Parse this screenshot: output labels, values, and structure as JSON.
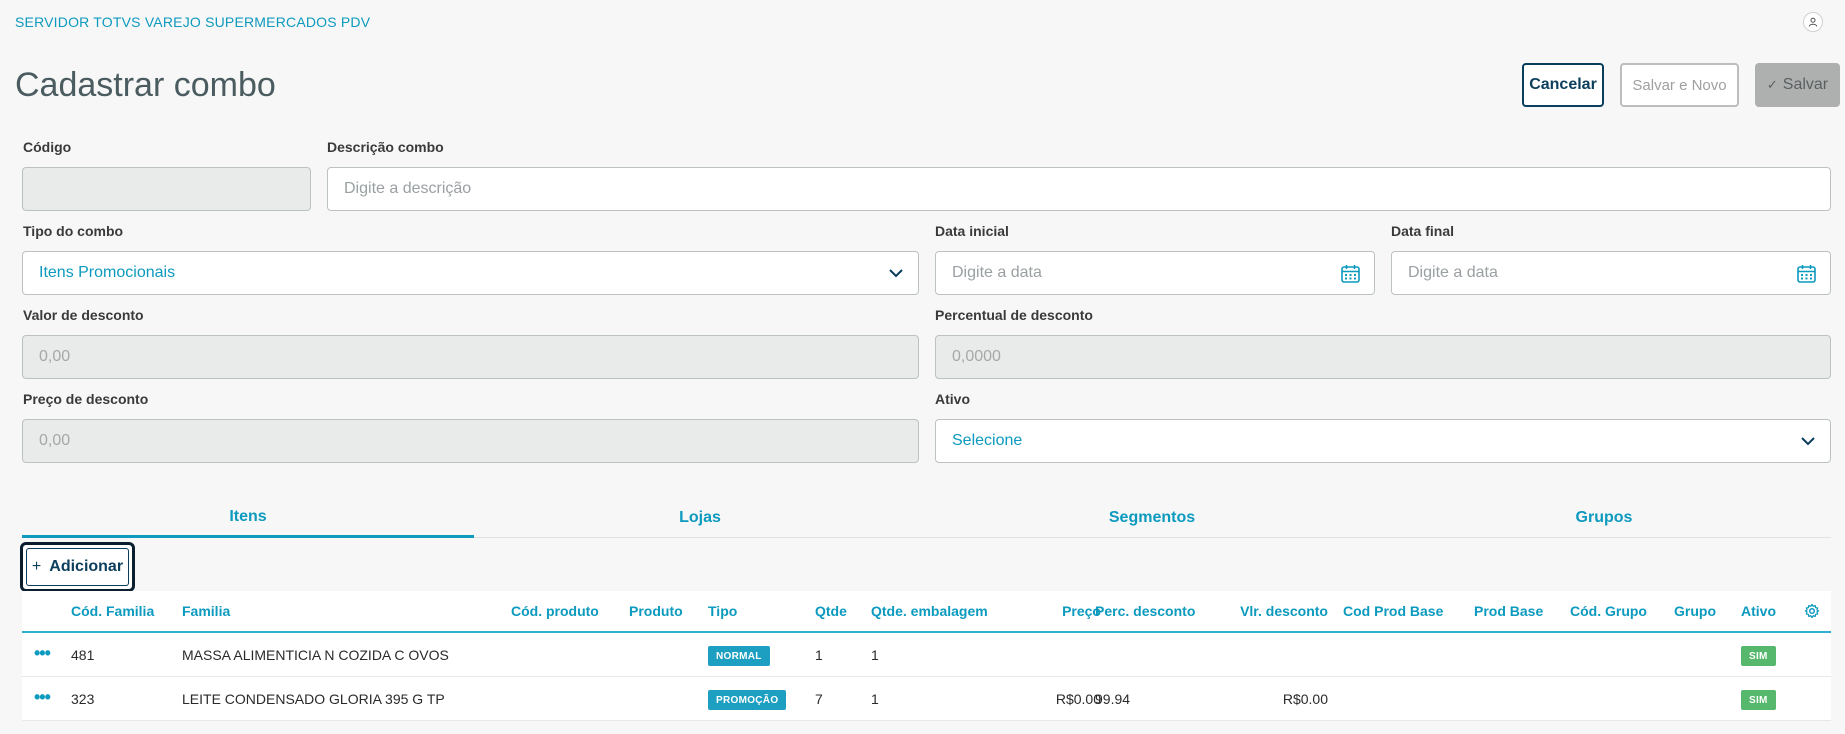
{
  "app": {
    "title": "SERVIDOR TOTVS VAREJO SUPERMERCADOS PDV"
  },
  "page": {
    "title": "Cadastrar combo"
  },
  "actions": {
    "cancel": "Cancelar",
    "save_new": "Salvar e Novo",
    "save": "Salvar"
  },
  "form": {
    "codigo": {
      "label": "Código",
      "value": ""
    },
    "descricao": {
      "label": "Descrição combo",
      "placeholder": "Digite a descrição"
    },
    "tipo": {
      "label": "Tipo do combo",
      "value": "Itens Promocionais"
    },
    "data_inicial": {
      "label": "Data inicial",
      "placeholder": "Digite a data"
    },
    "data_final": {
      "label": "Data final",
      "placeholder": "Digite a data"
    },
    "valor_desconto": {
      "label": "Valor de desconto",
      "placeholder": "0,00"
    },
    "percentual_desconto": {
      "label": "Percentual de desconto",
      "placeholder": "0,0000"
    },
    "preco_desconto": {
      "label": "Preço de desconto",
      "placeholder": "0,00"
    },
    "ativo": {
      "label": "Ativo",
      "value": "Selecione"
    }
  },
  "tabs": [
    {
      "label": "Itens",
      "active": true
    },
    {
      "label": "Lojas",
      "active": false
    },
    {
      "label": "Segmentos",
      "active": false
    },
    {
      "label": "Grupos",
      "active": false
    }
  ],
  "add_button": {
    "label": "Adicionar"
  },
  "table": {
    "columns": [
      "Cód. Familia",
      "Familia",
      "Cód. produto",
      "Produto",
      "Tipo",
      "Qtde",
      "Qtde. embalagem",
      "Preço",
      "Perc. desconto",
      "Vlr. desconto",
      "Cod Prod Base",
      "Prod Base",
      "Cód. Grupo",
      "Grupo",
      "Ativo"
    ],
    "rows": [
      {
        "cod_familia": "481",
        "familia": "MASSA ALIMENTICIA N COZIDA C OVOS",
        "cod_produto": "",
        "produto": "",
        "tipo": "NORMAL",
        "qtde": "1",
        "qtde_embalagem": "1",
        "preco": "",
        "perc_desconto": "",
        "vlr_desconto": "",
        "cod_prod_base": "",
        "prod_base": "",
        "cod_grupo": "",
        "grupo": "",
        "ativo": "SIM"
      },
      {
        "cod_familia": "323",
        "familia": "LEITE CONDENSADO GLORIA 395 G TP",
        "cod_produto": "",
        "produto": "",
        "tipo": "PROMOÇÃO",
        "qtde": "7",
        "qtde_embalagem": "1",
        "preco": "R$0.00",
        "perc_desconto": "99.94",
        "vlr_desconto": "R$0.00",
        "cod_prod_base": "",
        "prod_base": "",
        "cod_grupo": "",
        "grupo": "",
        "ativo": "SIM"
      }
    ]
  },
  "colors": {
    "accent": "#0c9abe",
    "dark": "#0b3d5c",
    "badge_blue": "#1d9fc1",
    "badge_green": "#56b86c"
  }
}
